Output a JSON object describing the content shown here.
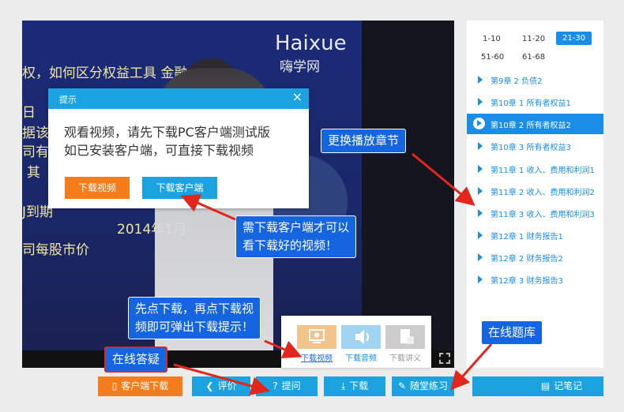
{
  "video": {
    "logo_en": "Haixue",
    "logo_cn": "嗨学网",
    "slide_lines": [
      "权，如何区分权益工具 金融",
      "日  ",
      "据该",
      "司有",
      "其",
      "J到期",
      "2014年1月",
      "司每股市价"
    ]
  },
  "sidebar": {
    "pages": [
      "1-10",
      "11-20",
      "21-30",
      "51-60",
      "61-68"
    ],
    "active_page": "21-30",
    "chapters": [
      "第9章 2 负债2",
      "第10章 1 所有者权益1",
      "第10章 2 所有者权益2",
      "第10章 3 所有者权益3",
      "第11章 1 收入、费用和利润1",
      "第11章 2 收入、费用和利润2",
      "第11章 3 收入、费用和利润3",
      "第12章 1 财务报告1",
      "第12章 2 财务报告2",
      "第12章 3 财务报告3"
    ],
    "active_chapter_index": 2
  },
  "dialog": {
    "title": "提示",
    "close_icon": "close-icon",
    "message_line1": "观看视频，请先下载PC客户端测试版",
    "message_line2": "如已安装客户端，可直接下载视频",
    "download_video_button": "下载视频",
    "download_client_button": "下载客户端"
  },
  "callouts": {
    "change_chapter": "更换播放章节",
    "need_client_line1": "需下载客户端才可以",
    "need_client_line2": "看下载好的视频！",
    "click_download_line1": "先点下载，再点下载视",
    "click_download_line2": "频即可弹出下载提示！",
    "online_qa": "在线答疑",
    "online_question_bank": "在线题库"
  },
  "download_popup": {
    "items": [
      {
        "label": "下载视频",
        "icon": "monitor-icon",
        "color": "#f2c48c",
        "label_color": "#1a6ee6"
      },
      {
        "label": "下载音频",
        "icon": "speaker-icon",
        "color": "#9fd5f2",
        "label_color": "#1a8ee6"
      },
      {
        "label": "下载讲义",
        "icon": "document-icon",
        "color": "#cccccc",
        "label_color": "#999999"
      }
    ]
  },
  "bottom_bar": {
    "client_download": "客户端下载",
    "comment": "评价",
    "ask": "提问",
    "download": "下载",
    "practice": "随堂练习",
    "notes": "记笔记"
  },
  "colors": {
    "primary_blue": "#1aa3e0",
    "orange": "#f47c1a",
    "callout_blue": "#1565e0",
    "arrow_red": "#e3261b"
  }
}
